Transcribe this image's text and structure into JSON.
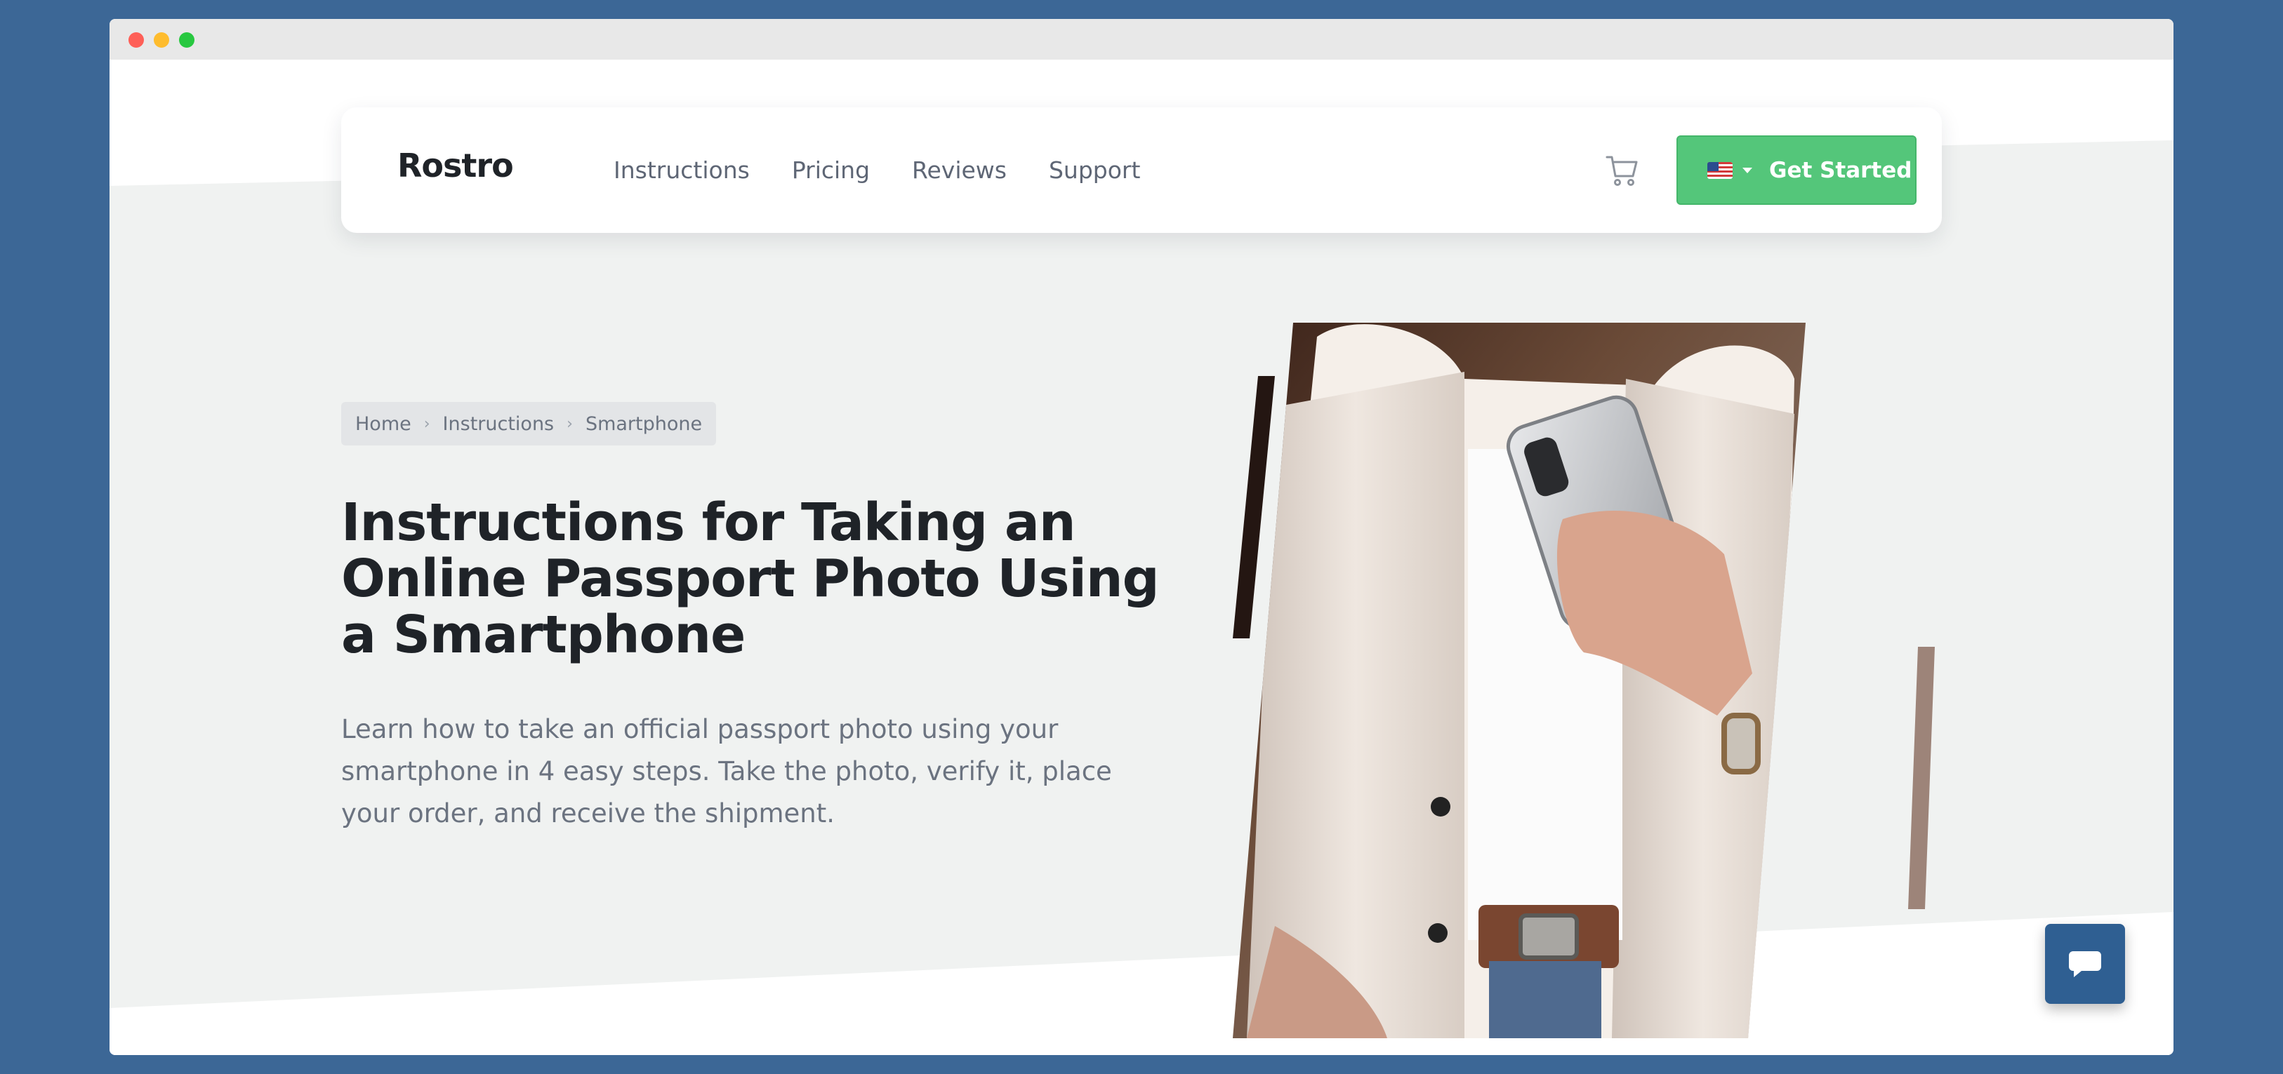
{
  "brand": {
    "name": "Rostro",
    "accent": "#54c67a",
    "chat_color": "#2f5f92"
  },
  "nav": {
    "links": [
      "Instructions",
      "Pricing",
      "Reviews",
      "Support"
    ],
    "cart_icon": "shopping-cart-icon",
    "language_flag": "us-flag-icon",
    "cta_label": "Get Started"
  },
  "breadcrumb": [
    "Home",
    "Instructions",
    "Smartphone"
  ],
  "hero": {
    "title": "Instructions for Taking an Online Passport Photo Using a Smartphone",
    "description": "Learn how to take an official passport photo using your smartphone in 4 easy steps. Take the photo, verify it, place your order, and receive the shipment.",
    "image_subject": "person holding a smartphone"
  },
  "chat": {
    "icon": "chat-bubble-icon"
  }
}
